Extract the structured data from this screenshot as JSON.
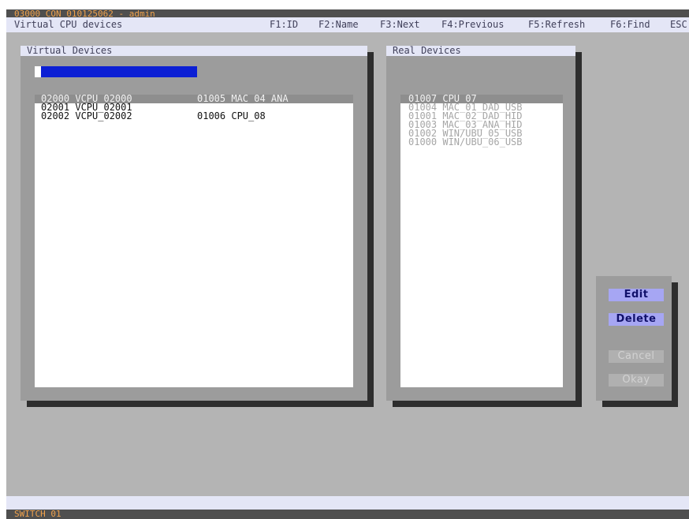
{
  "window": {
    "title": "03000 CON_010125062 - admin",
    "screen_title": "Virtual CPU devices"
  },
  "function_keys": [
    {
      "label": "F1:ID"
    },
    {
      "label": "F2:Name"
    },
    {
      "label": "F3:Next"
    },
    {
      "label": "F4:Previous"
    },
    {
      "label": "F5:Refresh"
    },
    {
      "label": "F6:Find"
    },
    {
      "label": "ESC"
    }
  ],
  "virtual_panel": {
    "title": "Virtual Devices",
    "search_value": "",
    "rows": [
      {
        "virtual": "02000 VCPU_02000",
        "assigned": "01005 MAC_04_ANA",
        "selected": true
      },
      {
        "virtual": "02001 VCPU_02001",
        "assigned": "",
        "selected": false
      },
      {
        "virtual": "02002 VCPU_02002",
        "assigned": "01006 CPU_08",
        "selected": false
      }
    ]
  },
  "real_panel": {
    "title": "Real Devices",
    "rows": [
      {
        "label": "01007 CPU_07",
        "selected": true,
        "available": true
      },
      {
        "label": "01004 MAC_01_DAD_USB",
        "selected": false,
        "available": false
      },
      {
        "label": "01001 MAC_02_DAD_HID",
        "selected": false,
        "available": false
      },
      {
        "label": "01003 MAC_03_ANA_HID",
        "selected": false,
        "available": false
      },
      {
        "label": "01002 WIN/UBU_05_USB",
        "selected": false,
        "available": false
      },
      {
        "label": "01000 WIN/UBU_06_USB",
        "selected": false,
        "available": false
      }
    ]
  },
  "actions": {
    "edit": "Edit",
    "delete": "Delete",
    "cancel": "Cancel",
    "okay": "Okay"
  },
  "status": {
    "text": "SWITCH 01"
  }
}
